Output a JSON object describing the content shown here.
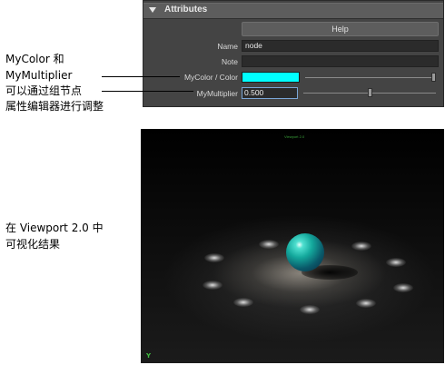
{
  "attribute_editor": {
    "section_title": "Attributes",
    "help_label": "Help",
    "rows": {
      "name": {
        "label": "Name",
        "value": "node"
      },
      "note": {
        "label": "Note",
        "value": ""
      },
      "color": {
        "label": "MyColor / Color",
        "swatch_color": "#00ffff",
        "slider_level": 1.0
      },
      "multiplier": {
        "label": "MyMultiplier",
        "value": "0.500",
        "slider_level": 0.5
      }
    }
  },
  "annotations": {
    "attr_note": {
      "line1": "MyColor 和",
      "line2": "MyMultiplier",
      "line3": "可以通过组节点",
      "line4": "属性编辑器进行调整"
    },
    "viewport_note": {
      "line1": "在 Viewport 2.0 中",
      "line2": "可视化结果"
    }
  },
  "viewport": {
    "overlay_label": "Viewport 2.0",
    "axis_label": "Y",
    "sphere_color": "#14a89c"
  }
}
